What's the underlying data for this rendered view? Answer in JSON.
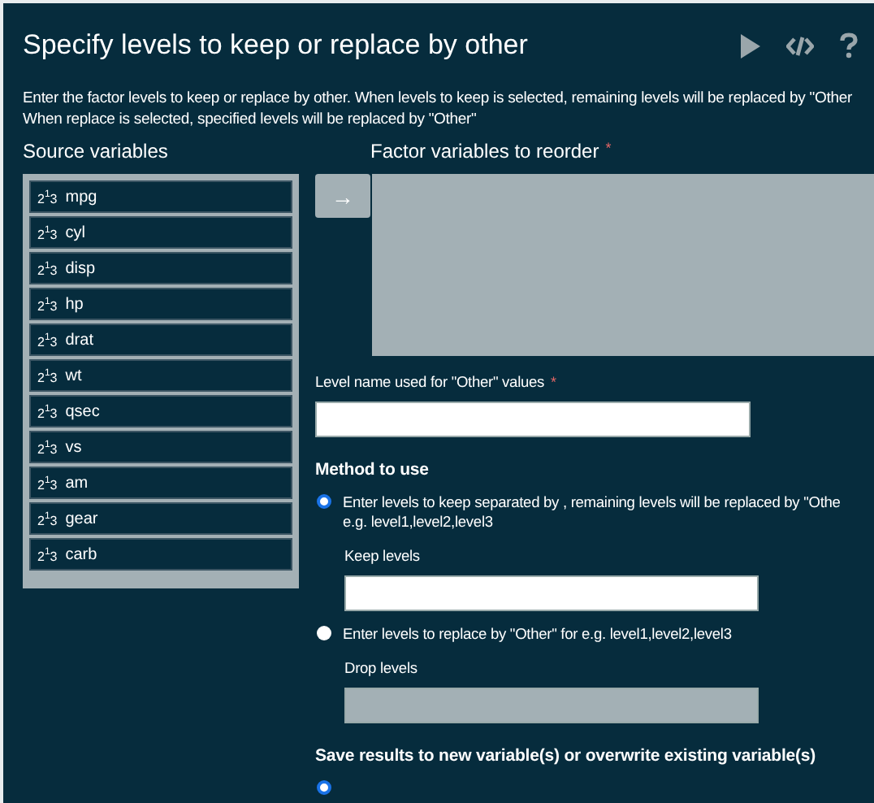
{
  "title": "Specify levels to keep or replace by other",
  "toolbar": [
    {
      "kind": "run"
    },
    {
      "kind": "code"
    },
    {
      "kind": "help"
    }
  ],
  "description": [
    "Enter the factor levels to keep or replace by other. When levels to keep is selected, remaining levels will be replaced by \"Other",
    "When replace is selected, specified levels will be replaced by \"Other\""
  ],
  "source": {
    "label": "Source variables",
    "items": [
      {
        "type_mark": "2$^{1}$3",
        "name": "mpg"
      },
      {
        "type_mark": "2$^{1}$3",
        "name": "cyl"
      },
      {
        "type_mark": "2$^{1}$3",
        "name": "disp"
      },
      {
        "type_mark": "2$^{1}$3",
        "name": "hp"
      },
      {
        "type_mark": "2$^{1}$3",
        "name": "drat"
      },
      {
        "type_mark": "2$^{1}$3",
        "name": "wt"
      },
      {
        "type_mark": "2$^{1}$3",
        "name": "qsec"
      },
      {
        "type_mark": "2$^{1}$3",
        "name": "vs"
      },
      {
        "type_mark": "2$^{1}$3",
        "name": "am"
      },
      {
        "type_mark": "2$^{1}$3",
        "name": "gear"
      },
      {
        "type_mark": "2$^{1}$3",
        "name": "carb"
      }
    ]
  },
  "move_button": {
    "icon": "→"
  },
  "target": {
    "label": "Factor variables to reorder",
    "required_mark": "*"
  },
  "other_name": {
    "label": "Level name used for \"Other\" values",
    "required_mark": "*"
  },
  "method": {
    "label": "Method to use",
    "options": [
      {
        "label": "Enter levels to keep separated by , remaining levels will be replaced by \"Othe",
        "hint": "e.g. level1,level2,level3",
        "selected": true,
        "field_label": "Keep levels",
        "disabled": false
      },
      {
        "label": "Enter levels to replace by \"Other\" for e.g. level1,level2,level3",
        "selected": false,
        "field_label": "Drop levels",
        "disabled": true
      }
    ]
  },
  "save": {
    "label": "Save results to new variable(s) or overwrite existing variable(s)",
    "options": [
      {
        "selected": true
      }
    ]
  }
}
